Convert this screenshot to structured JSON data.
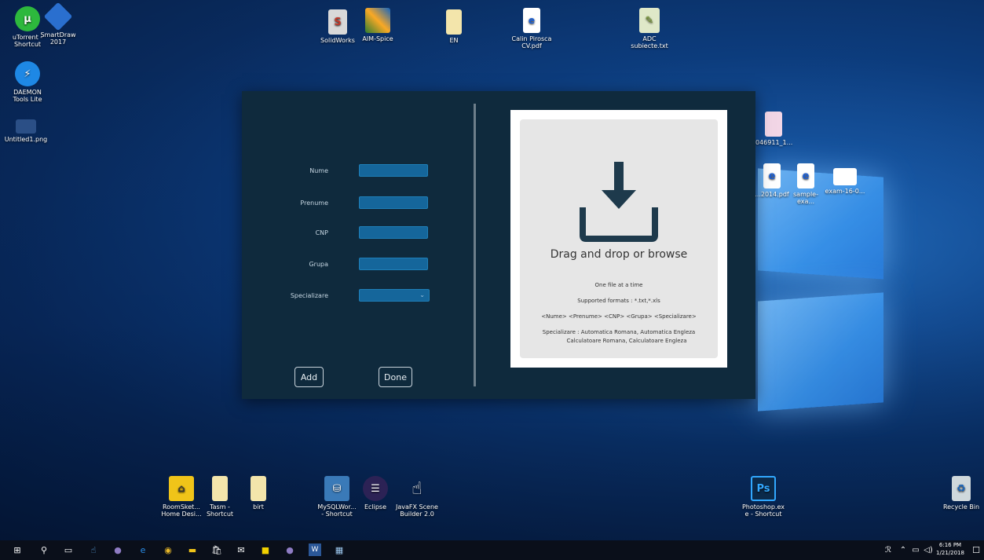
{
  "desktop": {
    "icons_top_left": [
      {
        "label": "uTorrent -\nShortcut",
        "icon": "utorrent-icon",
        "color": "#2db83d"
      },
      {
        "label": "SmartDraw\n2017",
        "icon": "smartdraw-icon",
        "color": "#2a6fcf"
      },
      {
        "label": "DAEMON\nTools Lite",
        "icon": "daemon-tools-icon",
        "color": "#1e88e5"
      },
      {
        "label": "Untitled1.png",
        "icon": "image-file-icon",
        "color": "#3f6db5"
      }
    ],
    "icons_top": [
      {
        "label": "SolidWorks",
        "icon": "solidworks-icon"
      },
      {
        "label": "AIM-Spice",
        "icon": "aimspice-icon"
      },
      {
        "label": "EN",
        "icon": "folder-icon"
      },
      {
        "label": "Calin Pirosca\nCV.pdf",
        "icon": "pdf-icon"
      },
      {
        "label": "ADC\nsubiecte.txt",
        "icon": "notepad-icon"
      }
    ],
    "icons_right": [
      {
        "label": "046911_1...",
        "icon": "image-file-icon"
      },
      {
        "label": "...2014.pdf",
        "icon": "pdf-icon"
      },
      {
        "label": "sample-exa...",
        "icon": "pdf-icon"
      },
      {
        "label": "exam-16-0...",
        "icon": "document-icon"
      }
    ],
    "icons_bottom": [
      {
        "label": "RoomSket...\nHome Desi...",
        "icon": "roomsketcher-icon"
      },
      {
        "label": "Tasm -\nShortcut",
        "icon": "folder-icon"
      },
      {
        "label": "birt",
        "icon": "folder-icon"
      },
      {
        "label": "MySQLWor...\n- Shortcut",
        "icon": "mysql-workbench-icon"
      },
      {
        "label": "Eclipse",
        "icon": "eclipse-icon"
      },
      {
        "label": "JavaFX Scene\nBuilder 2.0",
        "icon": "scenebuilder-icon"
      },
      {
        "label": "Photoshop.ex\ne - Shortcut",
        "icon": "photoshop-icon"
      },
      {
        "label": "Recycle Bin",
        "icon": "recycle-bin-icon"
      }
    ]
  },
  "form": {
    "fields": [
      {
        "label": "Nume",
        "value": ""
      },
      {
        "label": "Prenume",
        "value": ""
      },
      {
        "label": "CNP",
        "value": ""
      },
      {
        "label": "Grupa",
        "value": ""
      }
    ],
    "select_label": "Specializare",
    "select_value": "",
    "add_label": "Add",
    "done_label": "Done"
  },
  "dropzone": {
    "title": "Drag and drop or browse",
    "line1": "One file at a time",
    "line2": "Supported formats : *.txt,*.xls",
    "line3": "<Nume> <Prenume> <CNP> <Grupa> <Specializare>",
    "line4a": "Specializare : Automatica Romana, Automatica Engleza",
    "line4b": "Calculatoare Romana, Calculatoare Engleza"
  },
  "taskbar": {
    "time": "6:16 PM",
    "date": "1/21/2018",
    "apps": [
      "start-icon",
      "search-icon",
      "task-view-icon",
      "scenebuilder-icon",
      "eclipse-icon",
      "edge-icon",
      "chrome-icon",
      "file-explorer-icon",
      "store-icon",
      "mail-icon",
      "sticky-notes-icon",
      "eclipse-icon",
      "word-icon",
      "java-app-icon"
    ]
  }
}
